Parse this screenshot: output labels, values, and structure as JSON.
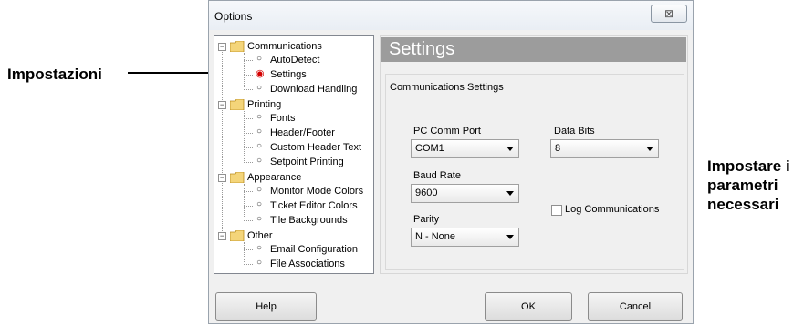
{
  "callouts": {
    "left": "Impostazioni",
    "right_line1": "Impostare i",
    "right_line2": "parametri",
    "right_line3": "necessari"
  },
  "window": {
    "title": "Options",
    "close_symbol": "⊠"
  },
  "tree": {
    "communications": {
      "label": "Communications",
      "children": [
        "AutoDetect",
        "Settings",
        "Download Handling"
      ]
    },
    "printing": {
      "label": "Printing",
      "children": [
        "Fonts",
        "Header/Footer",
        "Custom Header Text",
        "Setpoint Printing"
      ]
    },
    "appearance": {
      "label": "Appearance",
      "children": [
        "Monitor Mode Colors",
        "Ticket Editor Colors",
        "Tile Backgrounds"
      ]
    },
    "other": {
      "label": "Other",
      "children": [
        "Email Configuration",
        "File Associations"
      ]
    },
    "selected": "Settings"
  },
  "panel": {
    "header": "Settings",
    "group_title": "Communications Settings",
    "pc_comm_port": {
      "label": "PC Comm Port",
      "value": "COM1"
    },
    "baud_rate": {
      "label": "Baud Rate",
      "value": "9600"
    },
    "parity": {
      "label": "Parity",
      "value": "N - None"
    },
    "data_bits": {
      "label": "Data Bits",
      "value": "8"
    },
    "log_communications": {
      "label": "Log Communications",
      "checked": false
    }
  },
  "buttons": {
    "help": "Help",
    "ok": "OK",
    "cancel": "Cancel"
  },
  "colors": {
    "header_bg": "#9c9c9c",
    "selected_dot": "#d40000"
  }
}
